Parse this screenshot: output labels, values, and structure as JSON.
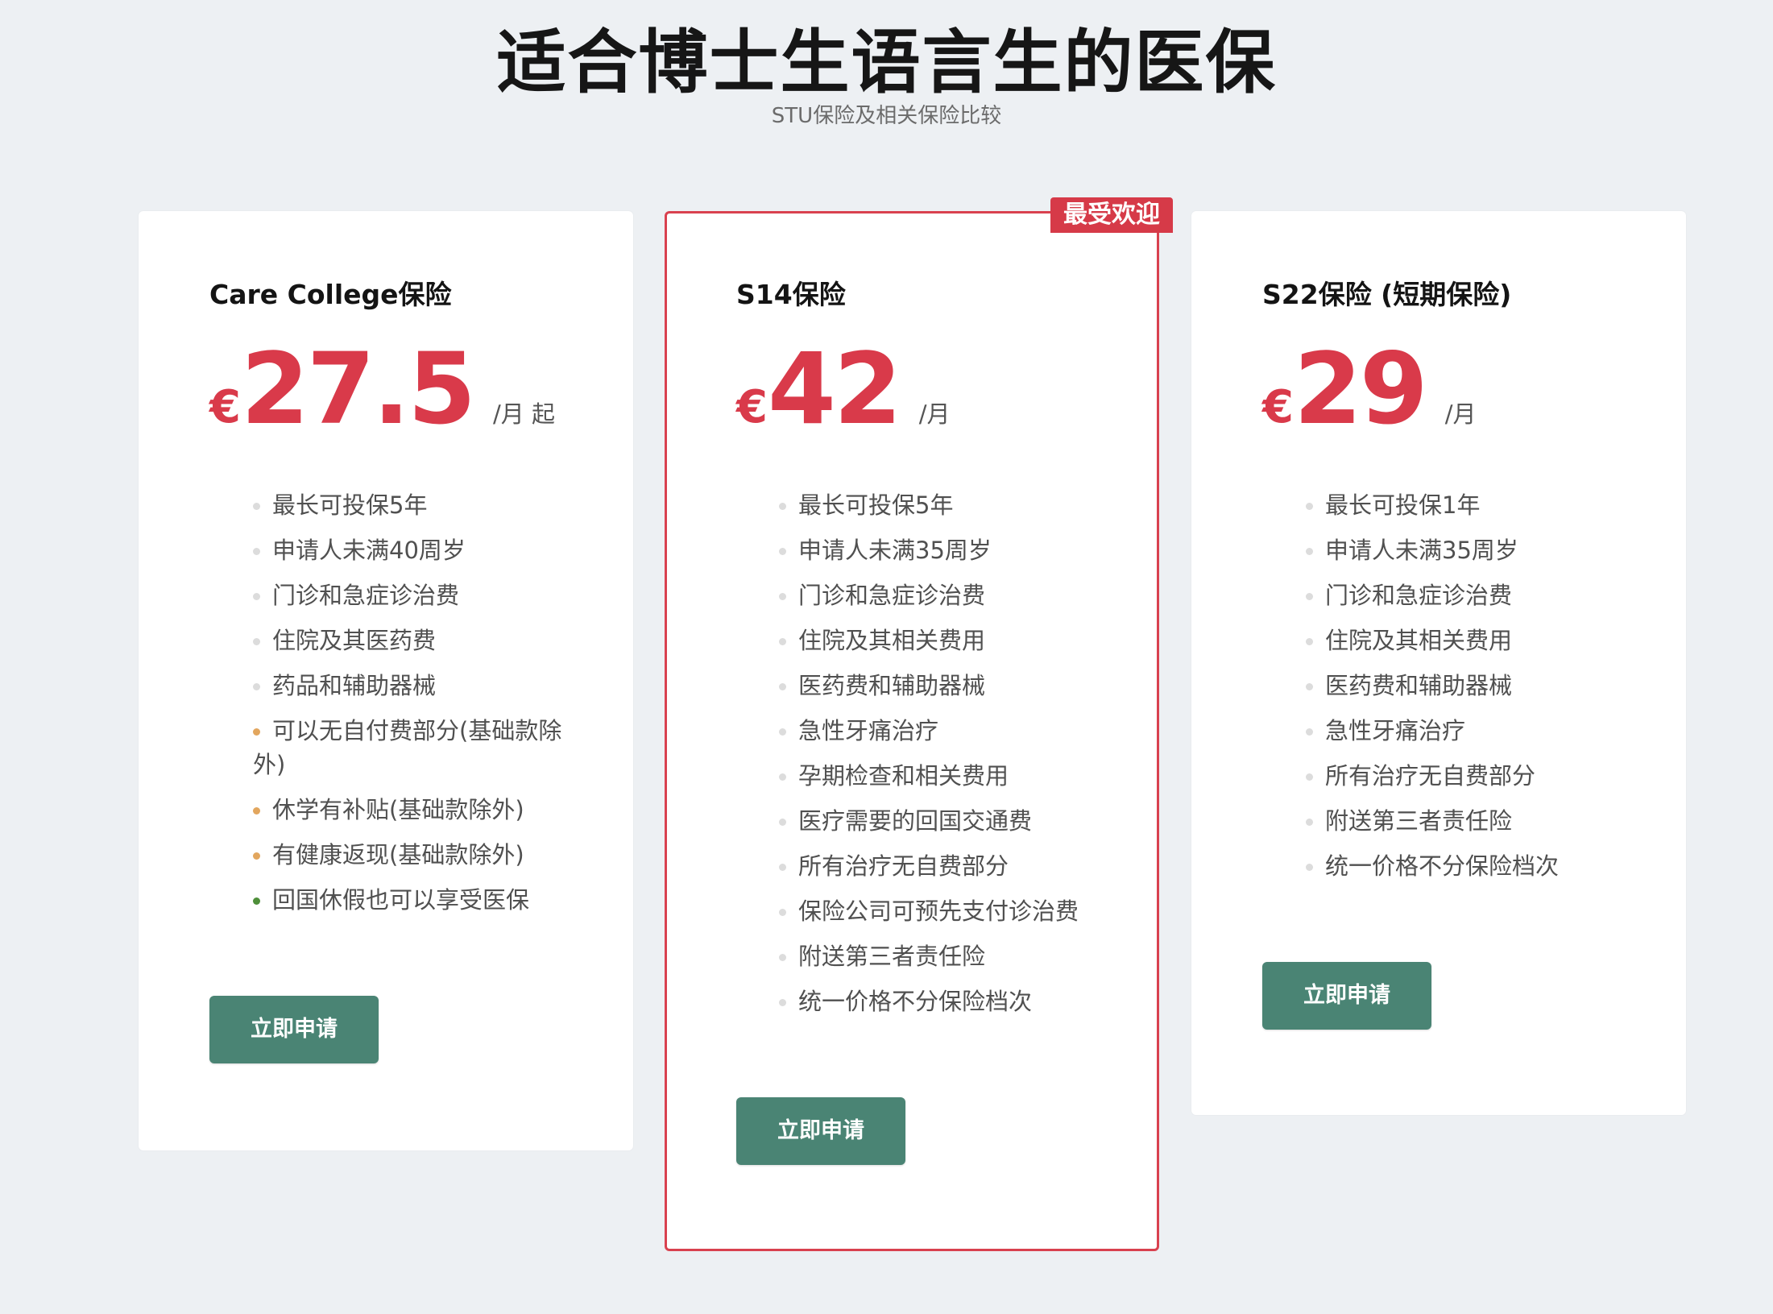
{
  "header": {
    "title": "适合博士生语言生的医保",
    "subtitle": "STU保险及相关保险比较"
  },
  "colors": {
    "accent_red": "#d93a4a",
    "button_green": "#4a8474",
    "bullet_default": "#dcdcdc",
    "bullet_orange": "#e2a65e",
    "bullet_green": "#4e8f3a"
  },
  "plans": [
    {
      "name": "Care College保险",
      "currency": "€",
      "price": "27.5",
      "period": "/月 起",
      "cta": "立即申请",
      "features": [
        {
          "text": "最长可投保5年",
          "bullet": "default"
        },
        {
          "text": "申请人未满40周岁",
          "bullet": "default"
        },
        {
          "text": "门诊和急症诊治费",
          "bullet": "default"
        },
        {
          "text": "住院及其医药费",
          "bullet": "default"
        },
        {
          "text": "药品和辅助器械",
          "bullet": "default"
        },
        {
          "text": "可以无自付费部分(基础款除外)",
          "bullet": "orange"
        },
        {
          "text": "休学有补贴(基础款除外)",
          "bullet": "orange"
        },
        {
          "text": "有健康返现(基础款除外)",
          "bullet": "orange"
        },
        {
          "text": "回国休假也可以享受医保",
          "bullet": "green"
        }
      ]
    },
    {
      "name": "S14保险",
      "badge": "最受欢迎",
      "currency": "€",
      "price": "42",
      "period": "/月",
      "cta": "立即申请",
      "features": [
        {
          "text": "最长可投保5年",
          "bullet": "default"
        },
        {
          "text": "申请人未满35周岁",
          "bullet": "default"
        },
        {
          "text": "门诊和急症诊治费",
          "bullet": "default"
        },
        {
          "text": "住院及其相关费用",
          "bullet": "default"
        },
        {
          "text": "医药费和辅助器械",
          "bullet": "default"
        },
        {
          "text": "急性牙痛治疗",
          "bullet": "default"
        },
        {
          "text": "孕期检查和相关费用",
          "bullet": "default"
        },
        {
          "text": "医疗需要的回国交通费",
          "bullet": "default"
        },
        {
          "text": "所有治疗无自费部分",
          "bullet": "default"
        },
        {
          "text": "保险公司可预先支付诊治费",
          "bullet": "default"
        },
        {
          "text": "附送第三者责任险",
          "bullet": "default"
        },
        {
          "text": "统一价格不分保险档次",
          "bullet": "default"
        }
      ]
    },
    {
      "name": "S22保险 (短期保险)",
      "currency": "€",
      "price": "29",
      "period": "/月",
      "cta": "立即申请",
      "features": [
        {
          "text": "最长可投保1年",
          "bullet": "default"
        },
        {
          "text": "申请人未满35周岁",
          "bullet": "default"
        },
        {
          "text": "门诊和急症诊治费",
          "bullet": "default"
        },
        {
          "text": "住院及其相关费用",
          "bullet": "default"
        },
        {
          "text": "医药费和辅助器械",
          "bullet": "default"
        },
        {
          "text": "急性牙痛治疗",
          "bullet": "default"
        },
        {
          "text": "所有治疗无自费部分",
          "bullet": "default"
        },
        {
          "text": "附送第三者责任险",
          "bullet": "default"
        },
        {
          "text": "统一价格不分保险档次",
          "bullet": "default"
        }
      ]
    }
  ]
}
